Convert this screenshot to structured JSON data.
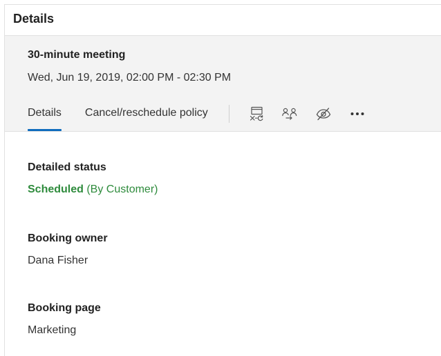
{
  "panel": {
    "title": "Details"
  },
  "summary": {
    "meeting_title": "30-minute meeting",
    "meeting_time": "Wed, Jun 19, 2019, 02:00 PM - 02:30 PM"
  },
  "tabs": [
    {
      "label": "Details",
      "active": true
    },
    {
      "label": "Cancel/reschedule policy",
      "active": false
    }
  ],
  "toolbar": {
    "icons": [
      "cancel-meeting-icon",
      "reassign-people-icon",
      "hide-icon",
      "more-options-icon"
    ]
  },
  "fields": {
    "detailed_status": {
      "label": "Detailed status",
      "value_strong": "Scheduled",
      "value_rest": " (By Customer)"
    },
    "booking_owner": {
      "label": "Booking owner",
      "value": "Dana Fisher"
    },
    "booking_page": {
      "label": "Booking page",
      "value": "Marketing"
    }
  },
  "colors": {
    "accent": "#0f6cbd",
    "status_green": "#2e8b3c",
    "summary_bg": "#f3f3f3"
  }
}
